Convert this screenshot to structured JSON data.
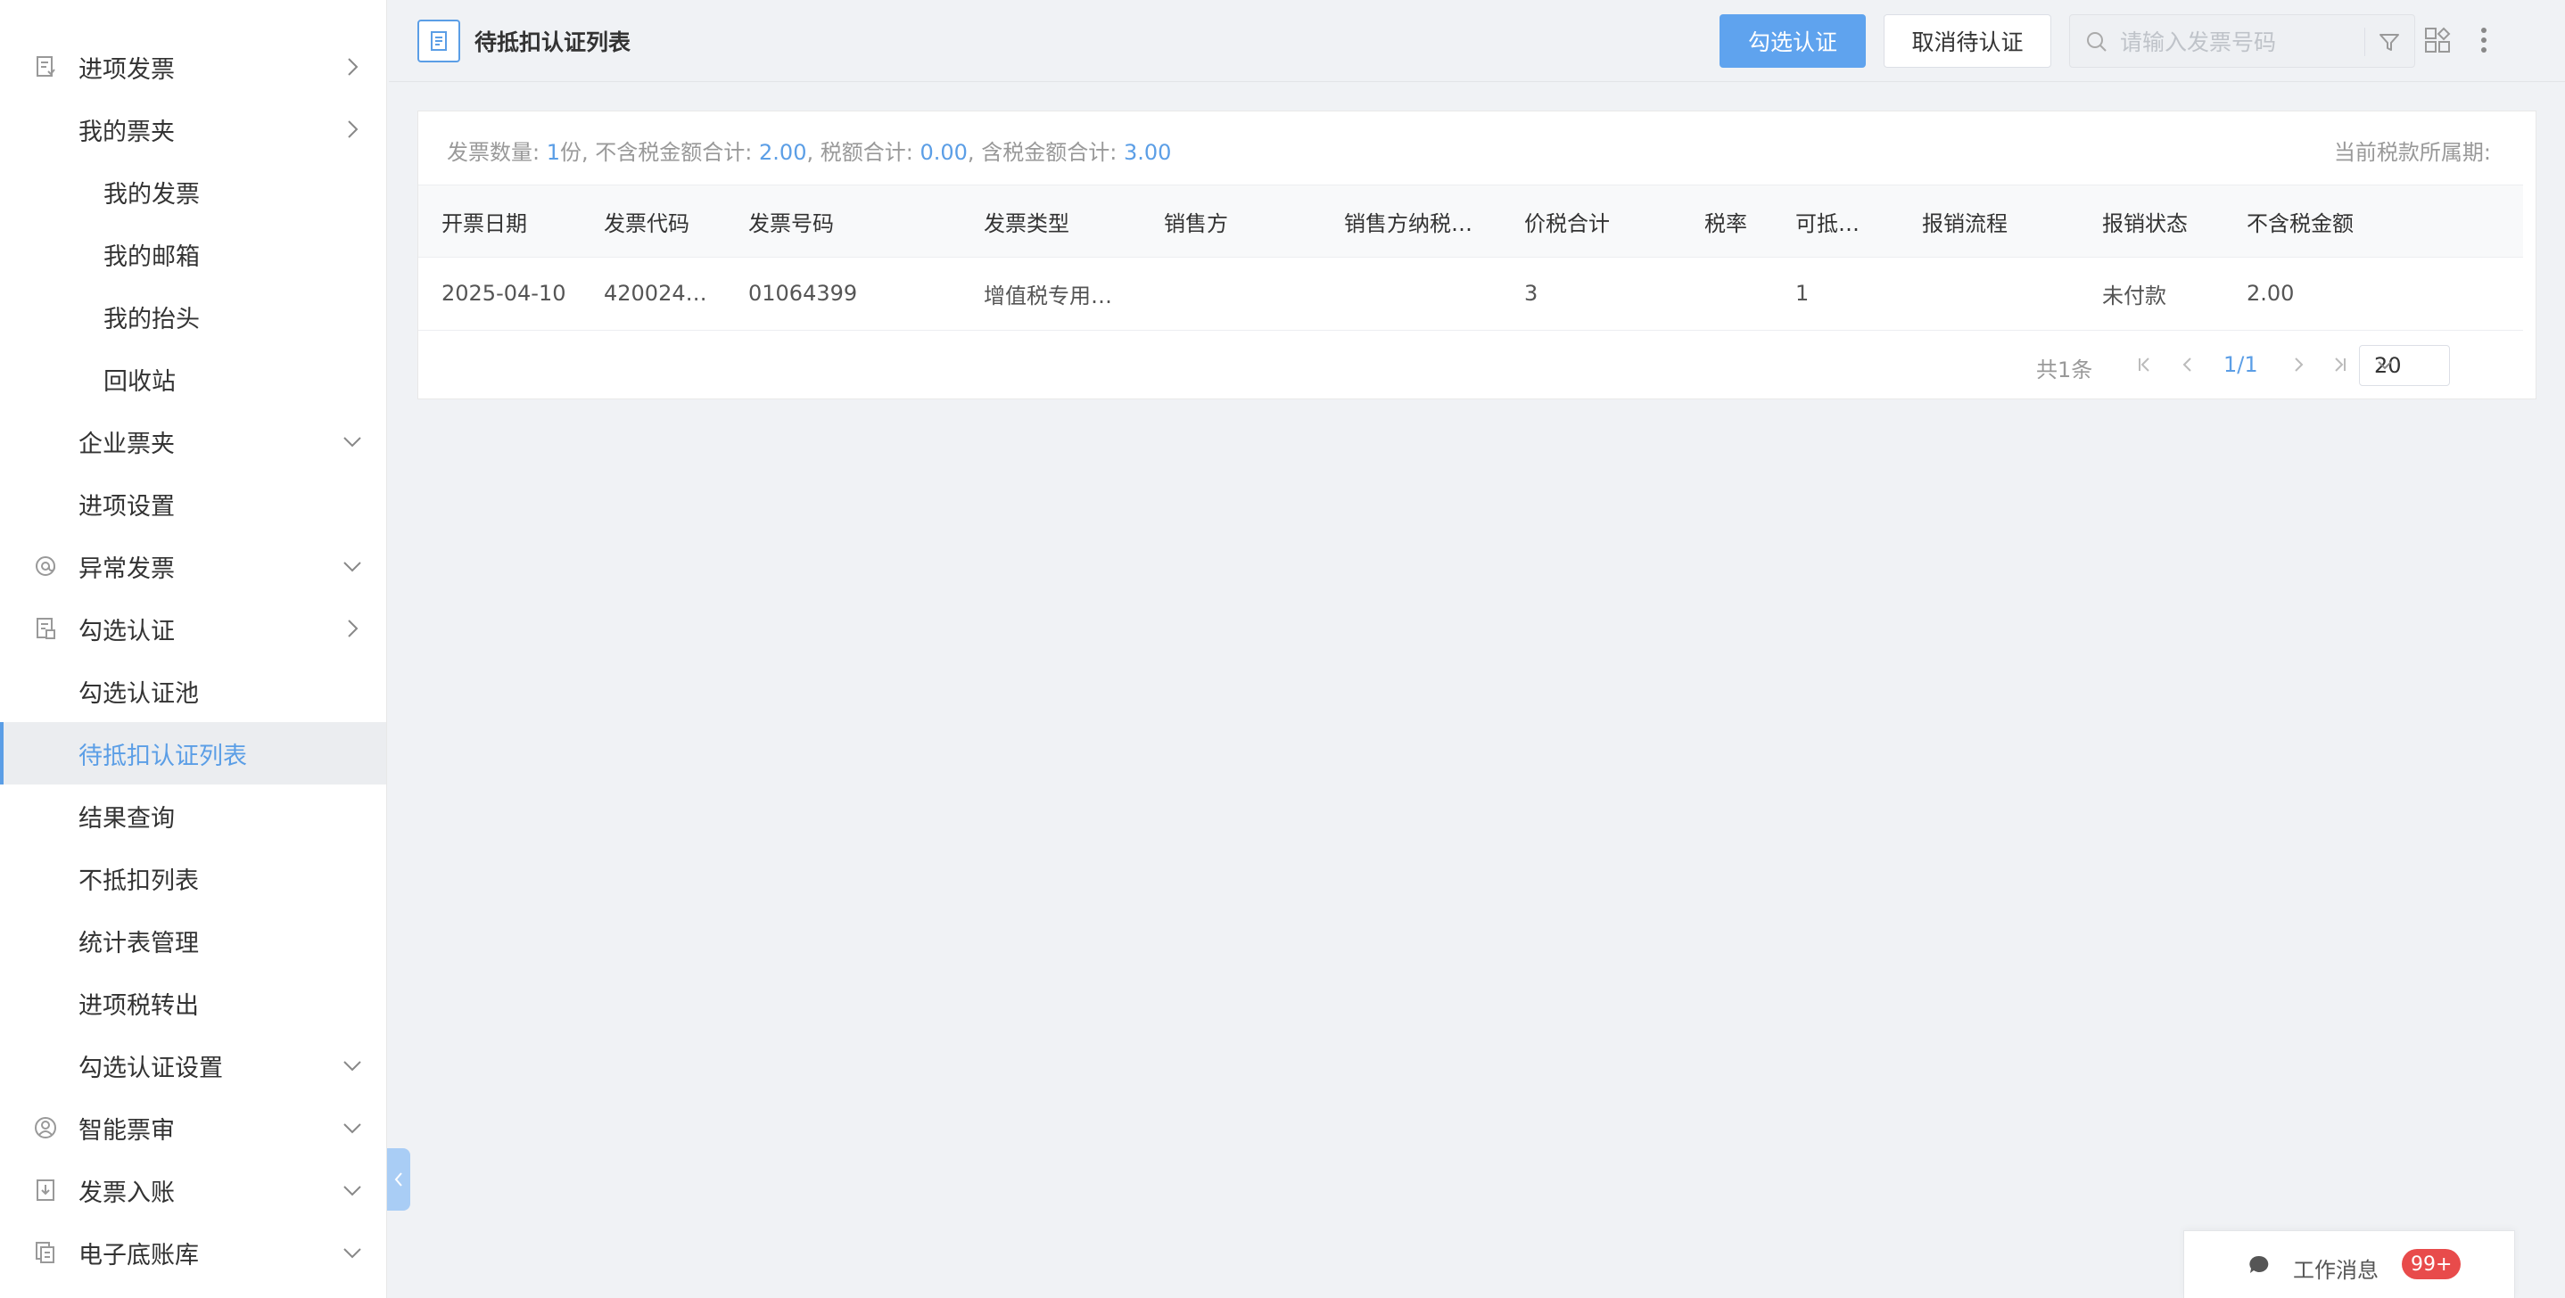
{
  "sidebar": {
    "items": [
      {
        "label": "进项发票",
        "icon": "invoice-icon",
        "arrow": "chevron-right-icon"
      },
      {
        "label": "我的票夹",
        "arrow": "chevron-right-icon"
      },
      {
        "label": "我的发票"
      },
      {
        "label": "我的邮箱"
      },
      {
        "label": "我的抬头"
      },
      {
        "label": "回收站"
      },
      {
        "label": "企业票夹",
        "arrow": "chevron-down-icon"
      },
      {
        "label": "进项设置"
      },
      {
        "label": "异常发票",
        "icon": "at-icon",
        "arrow": "chevron-down-icon"
      },
      {
        "label": "勾选认证",
        "icon": "check-document-icon",
        "arrow": "chevron-right-icon"
      },
      {
        "label": "勾选认证池"
      },
      {
        "label": "待抵扣认证列表",
        "active": true
      },
      {
        "label": "结果查询"
      },
      {
        "label": "不抵扣列表"
      },
      {
        "label": "统计表管理"
      },
      {
        "label": "进项税转出"
      },
      {
        "label": "勾选认证设置",
        "arrow": "chevron-down-icon"
      },
      {
        "label": "智能票审",
        "icon": "user-circle-icon",
        "arrow": "chevron-down-icon"
      },
      {
        "label": "发票入账",
        "icon": "download-document-icon",
        "arrow": "chevron-down-icon"
      },
      {
        "label": "电子底账库",
        "icon": "copy-document-icon",
        "arrow": "chevron-down-icon"
      }
    ]
  },
  "header": {
    "title": "待抵扣认证列表",
    "primary_button": "勾选认证",
    "secondary_button": "取消待认证",
    "search_placeholder": "请输入发票号码"
  },
  "summary": {
    "count_label": "发票数量:",
    "count_value": "1",
    "count_unit": "份,",
    "net_label": "不含税金额合计:",
    "net_value": "2.00",
    "tax_label": "税额合计:",
    "tax_value": "0.00",
    "gross_label": "含税金额合计:",
    "gross_value": "3.00",
    "sep": ",",
    "period_label": "当前税款所属期:"
  },
  "table": {
    "columns": [
      "开票日期",
      "发票代码",
      "发票号码",
      "发票类型",
      "销售方",
      "销售方纳税…",
      "价税合计",
      "税率",
      "可抵…",
      "报销流程",
      "报销状态",
      "不含税金额"
    ],
    "rows": [
      [
        "2025-04-10",
        "420024…",
        "01064399",
        "增值税专用…",
        "",
        "",
        "3",
        "",
        "1",
        "",
        "未付款",
        "2.00"
      ]
    ]
  },
  "pagination": {
    "total": "共1条",
    "page": "1/1",
    "page_size": "20"
  },
  "work_message": {
    "label": "工作消息",
    "badge": "99+"
  },
  "colors": {
    "accent": "#5b9ee6",
    "primary_button": "#5fa3ee",
    "badge": "#e84b4b"
  }
}
